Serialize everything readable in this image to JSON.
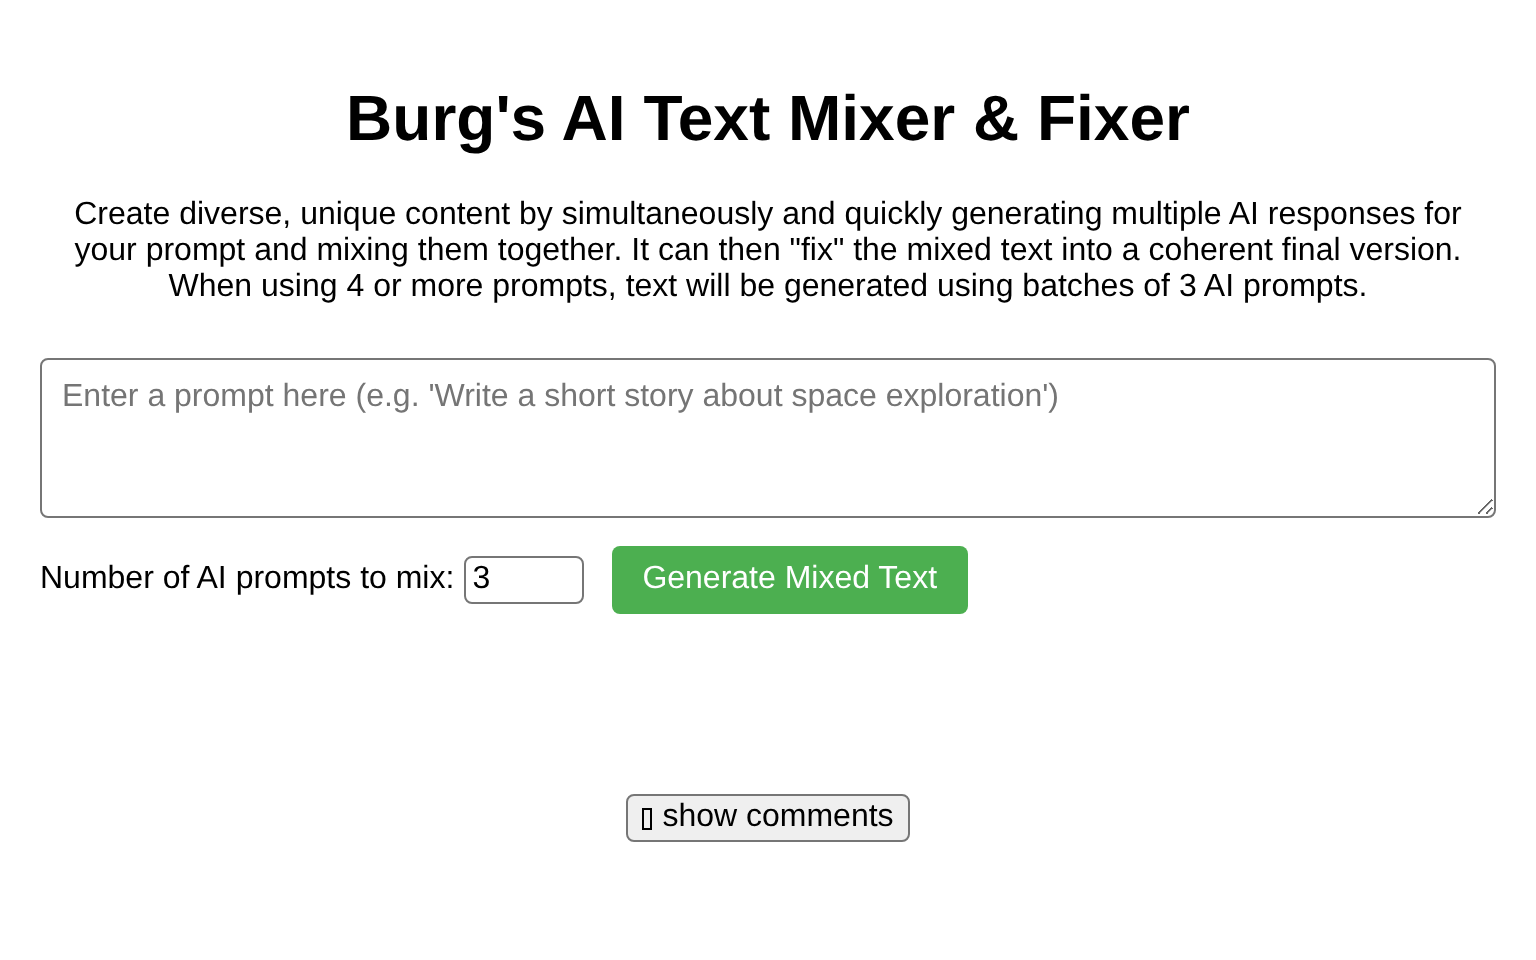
{
  "title": "Burg's AI Text Mixer & Fixer",
  "description": "Create diverse, unique content by simultaneously and quickly generating multiple AI responses for your prompt and mixing them together. It can then \"fix\" the mixed text into a coherent final version. When using 4 or more prompts, text will be generated using batches of 3 AI prompts.",
  "prompt": {
    "placeholder": "Enter a prompt here (e.g. 'Write a short story about space exploration')"
  },
  "count": {
    "label": "Number of AI prompts to mix:",
    "value": "3"
  },
  "generate_button": "Generate Mixed Text",
  "comments_button": "show comments"
}
